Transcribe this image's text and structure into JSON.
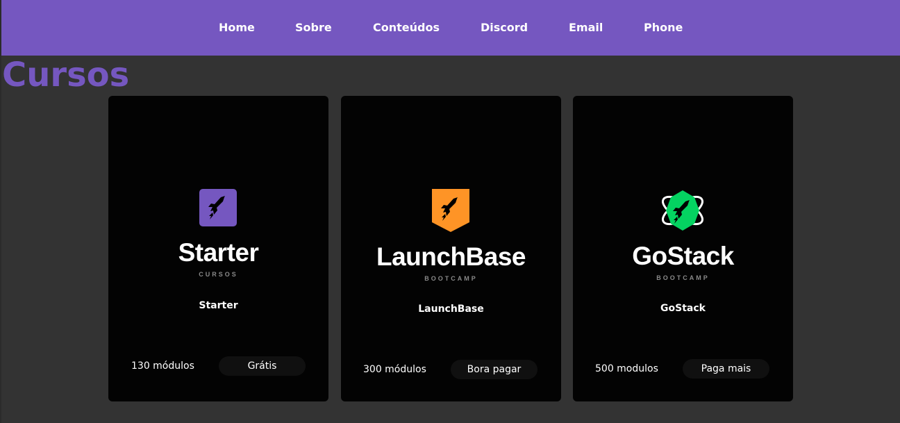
{
  "colors": {
    "brand_purple": "#7557c0",
    "background": "#333333",
    "card_background": "#030303",
    "starter_accent": "#7557c0",
    "launchbase_accent": "#fe9426",
    "gostack_accent": "#04d361"
  },
  "nav": {
    "items": [
      {
        "label": "Home"
      },
      {
        "label": "Sobre"
      },
      {
        "label": "Conteúdos"
      },
      {
        "label": "Discord"
      },
      {
        "label": "Email"
      },
      {
        "label": "Phone"
      }
    ]
  },
  "page_title": "Cursos",
  "cards": [
    {
      "logo_icon": "rocket-square-icon",
      "logo_name": "Starter",
      "logo_sub": "CURSOS",
      "title": "Starter",
      "modules": "130 módulos",
      "price": "Grátis"
    },
    {
      "logo_icon": "rocket-shield-icon",
      "logo_name": "LaunchBase",
      "logo_sub": "BOOTCAMP",
      "title": "LaunchBase",
      "modules": "300 módulos",
      "price": "Bora pagar"
    },
    {
      "logo_icon": "rocket-atom-icon",
      "logo_name": "GoStack",
      "logo_sub": "BOOTCAMP",
      "title": "GoStack",
      "modules": "500 modulos",
      "price": "Paga mais"
    }
  ]
}
